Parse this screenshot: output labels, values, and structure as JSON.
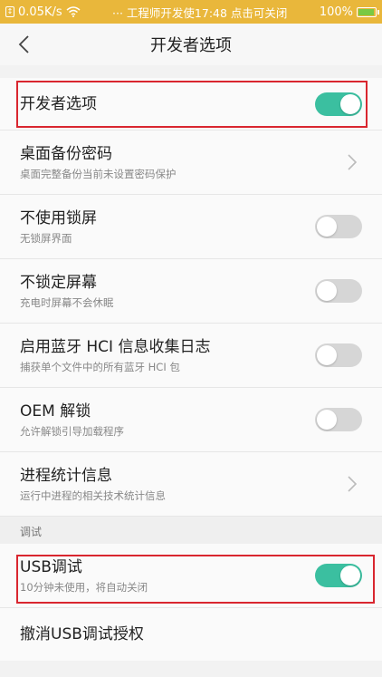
{
  "status_bar": {
    "speed": "0.05K/s",
    "center_text": "··· 工程师开发使17:48  点击可关闭",
    "battery": "100%",
    "battery_level": 1.0,
    "bar_color": "#e9b73b"
  },
  "header": {
    "title": "开发者选项",
    "back_icon": "chevron-left-icon"
  },
  "items": [
    {
      "title": "开发者选项",
      "subtitle": "",
      "control": "toggle",
      "on": true
    },
    {
      "title": "桌面备份密码",
      "subtitle": "桌面完整备份当前未设置密码保护",
      "control": "chevron"
    },
    {
      "title": "不使用锁屏",
      "subtitle": "无锁屏界面",
      "control": "toggle",
      "on": false
    },
    {
      "title": "不锁定屏幕",
      "subtitle": "充电时屏幕不会休眠",
      "control": "toggle",
      "on": false
    },
    {
      "title": "启用蓝牙 HCI 信息收集日志",
      "subtitle": "捕获单个文件中的所有蓝牙 HCI 包",
      "control": "toggle",
      "on": false
    },
    {
      "title": "OEM 解锁",
      "subtitle": "允许解锁引导加载程序",
      "control": "toggle",
      "on": false
    },
    {
      "title": "进程统计信息",
      "subtitle": "运行中进程的相关技术统计信息",
      "control": "chevron"
    }
  ],
  "section": {
    "label": "调试"
  },
  "debug_items": [
    {
      "title": "USB调试",
      "subtitle": "10分钟未使用，将自动关闭",
      "control": "toggle",
      "on": true
    },
    {
      "title": "撤消USB调试授权",
      "subtitle": "",
      "control": "none"
    }
  ],
  "colors": {
    "accent": "#3bbfa0",
    "highlight": "#d9262f"
  }
}
